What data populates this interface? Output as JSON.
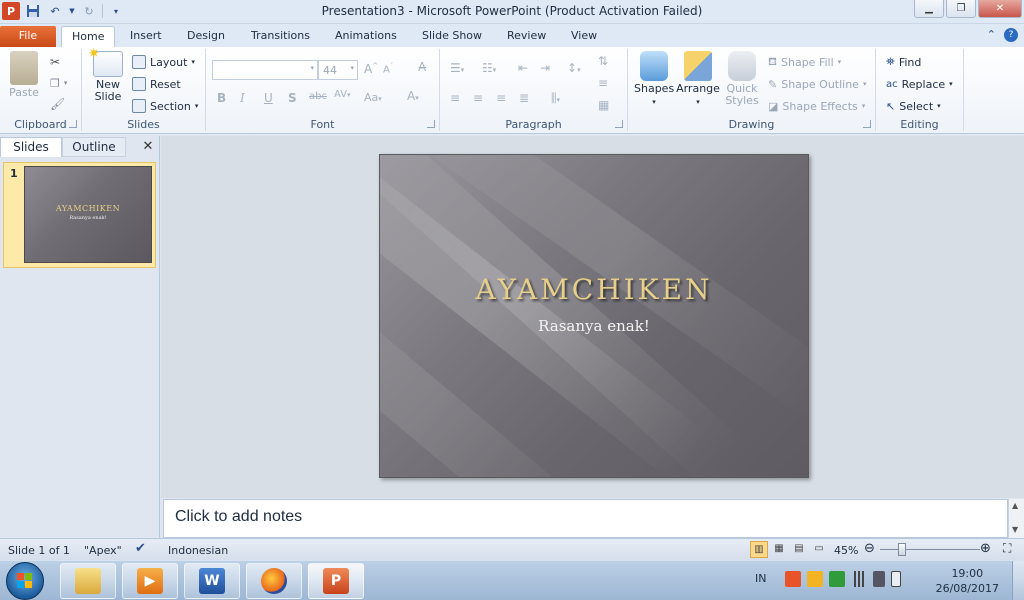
{
  "window": {
    "title": "Presentation3  -  Microsoft PowerPoint (Product Activation Failed)",
    "app_icon_letter": "P"
  },
  "tabs": [
    "File",
    "Home",
    "Insert",
    "Design",
    "Transitions",
    "Animations",
    "Slide Show",
    "Review",
    "View"
  ],
  "ribbon": {
    "clipboard": {
      "label": "Clipboard",
      "paste": "Paste"
    },
    "slides": {
      "label": "Slides",
      "new_slide_1": "New",
      "new_slide_2": "Slide",
      "layout": "Layout",
      "reset": "Reset",
      "section": "Section"
    },
    "font": {
      "label": "Font",
      "size": "44"
    },
    "paragraph": {
      "label": "Paragraph"
    },
    "drawing": {
      "label": "Drawing",
      "shapes": "Shapes",
      "arrange": "Arrange",
      "quick_styles_1": "Quick",
      "quick_styles_2": "Styles",
      "shape_fill": "Shape Fill",
      "shape_outline": "Shape Outline",
      "shape_effects": "Shape Effects"
    },
    "editing": {
      "label": "Editing",
      "find": "Find",
      "replace": "Replace",
      "select": "Select"
    }
  },
  "pane": {
    "tab_slides": "Slides",
    "tab_outline": "Outline",
    "thumb_number": "1",
    "thumb_title": "AYAMCHIKEN",
    "thumb_subtitle": "Rasanya enak!"
  },
  "slide": {
    "title": "AYAMCHIKEN",
    "subtitle": "Rasanya enak!"
  },
  "notes": {
    "placeholder": "Click to add notes"
  },
  "status": {
    "slide_count": "Slide 1 of 1",
    "theme": "\"Apex\"",
    "language": "Indonesian",
    "zoom": "45%"
  },
  "taskbar": {
    "lang": "IN",
    "time": "19:00",
    "date": "26/08/2017",
    "word_letter": "W",
    "ppt_letter": "P"
  },
  "colors": {
    "file_tab": "#d4561f",
    "slide_title": "#e6cf8a",
    "accent_blue": "#2a4f88"
  }
}
